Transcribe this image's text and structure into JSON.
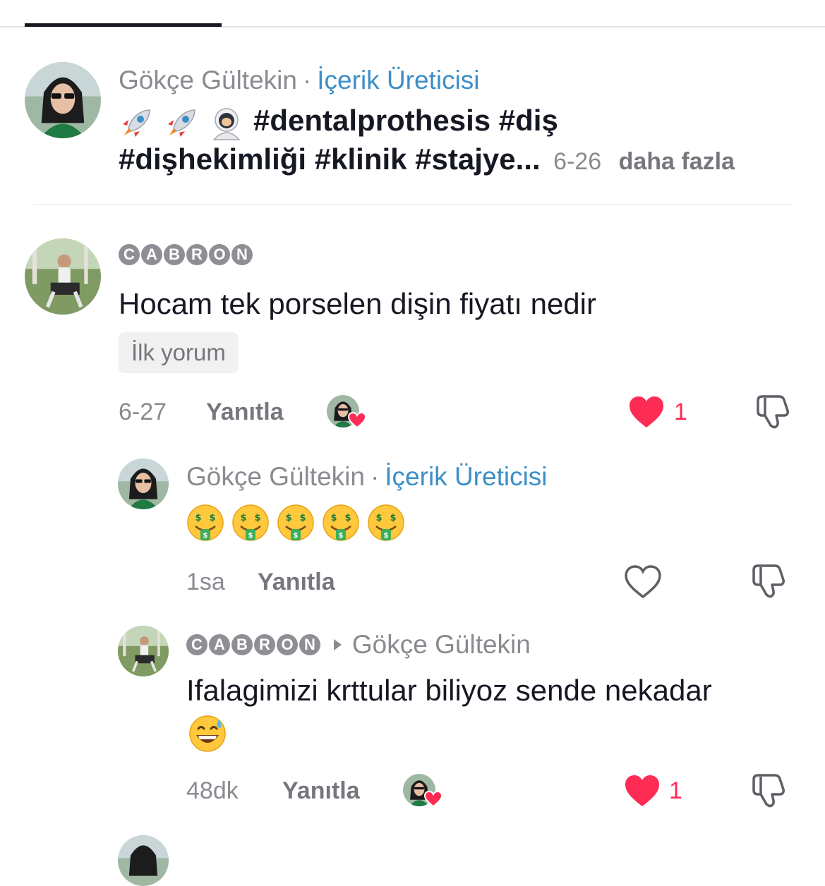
{
  "caption": {
    "author": "Gökçe Gültekin",
    "separator": "·",
    "role": "İçerik Üreticisi",
    "line1_tags": "#dentalprothesis #diş",
    "line2_tags": "#dişhekimliği #klinik #stajye...",
    "date": "6-26",
    "more": "daha fazla"
  },
  "comments": [
    {
      "author_letters": [
        "C",
        "A",
        "B",
        "R",
        "O",
        "N"
      ],
      "text": "Hocam tek porselen dişin fiyatı nedir",
      "badge": "İlk yorum",
      "time": "6-27",
      "reply": "Yanıtla",
      "likes": "1",
      "liked_by_creator": true
    },
    {
      "author": "Gökçe Gültekin",
      "separator": "·",
      "role": "İçerik Üreticisi",
      "emoji": [
        "money-mouth-face",
        "money-mouth-face",
        "money-mouth-face",
        "money-mouth-face",
        "money-mouth-face"
      ],
      "time": "1sa",
      "reply": "Yanıtla",
      "liked": false
    },
    {
      "author_letters": [
        "C",
        "A",
        "B",
        "R",
        "O",
        "N"
      ],
      "reply_to": "Gökçe Gültekin",
      "text": "Ifalagimizi krttular biliyoz sende nekadar",
      "emoji": "grinning-face-with-sweat",
      "time": "48dk",
      "reply": "Yanıtla",
      "likes": "1",
      "liked_by_creator": true
    }
  ],
  "colors": {
    "like_red": "#fe2c55",
    "creator_blue": "#3b8fc8",
    "muted": "#8a8b91"
  }
}
